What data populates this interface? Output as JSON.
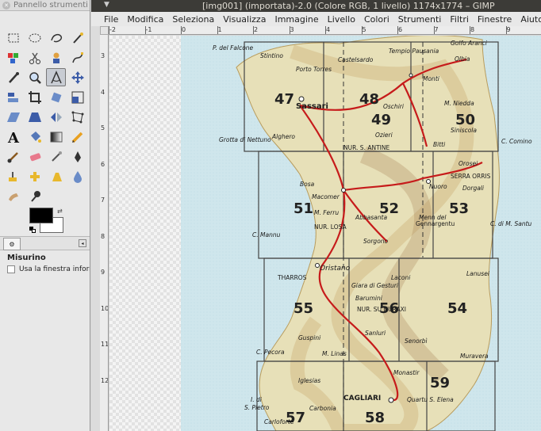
{
  "toolbox": {
    "title": "Pannello strumenti",
    "tools": [
      "rect-select-icon",
      "ellipse-select-icon",
      "free-select-icon",
      "fuzzy-select-icon",
      "color-select-icon",
      "scissors-icon",
      "foreground-select-icon",
      "paths-icon",
      "color-picker-icon",
      "zoom-icon",
      "measure-icon",
      "move-icon",
      "align-icon",
      "crop-icon",
      "rotate-icon",
      "scale-icon",
      "shear-icon",
      "perspective-icon",
      "flip-icon",
      "cage-icon",
      "text-icon",
      "bucket-fill-icon",
      "blend-icon",
      "pencil-icon",
      "paintbrush-icon",
      "eraser-icon",
      "airbrush-icon",
      "ink-icon",
      "clone-icon",
      "heal-icon",
      "perspective-clone-icon",
      "blur-icon",
      "smudge-icon",
      "dodge-burn-icon"
    ],
    "active_tool_index": 10,
    "fg_color": "#000000",
    "bg_color": "#ffffff"
  },
  "tool_options": {
    "tool_name": "Misurino",
    "option_label": "Usa la finestra informazioni"
  },
  "window": {
    "title": "[img001] (importata)-2.0 (Colore RGB, 1 livello) 1174x1774 – GIMP"
  },
  "menu": [
    "File",
    "Modifica",
    "Seleziona",
    "Visualizza",
    "Immagine",
    "Livello",
    "Colori",
    "Strumenti",
    "Filtri",
    "Finestre",
    "Aiuto"
  ],
  "rulers": {
    "horizontal": [
      "-2",
      "-1",
      "0",
      "1",
      "2",
      "3",
      "4",
      "5",
      "6",
      "7",
      "8",
      "9"
    ],
    "vertical": [
      "3",
      "4",
      "5",
      "6",
      "7",
      "8",
      "9",
      "10",
      "11",
      "12"
    ]
  },
  "map": {
    "sheet_numbers": [
      "47",
      "48",
      "49",
      "50",
      "51",
      "52",
      "53",
      "55",
      "56",
      "54",
      "59",
      "57",
      "58"
    ],
    "places": [
      "P. del Falcone",
      "Stintino",
      "Castelsardo",
      "Tempio Pausania",
      "Golfo Aranci",
      "Olbia",
      "Porto Torres",
      "Monti",
      "Sassari",
      "Oschiri",
      "M. Niedda",
      "Siniscola",
      "Ozieri",
      "Grotta di Nettuno",
      "Alghero",
      "Bitti",
      "C. Comino",
      "NUR. S. ANTINE",
      "Orosei",
      "SERRA ORRIS",
      "Bosa",
      "Nuoro",
      "Dorgali",
      "Macomer",
      "M. Ferru",
      "Gennargentu",
      "Abbasanta",
      "NUR. LOSA",
      "Sorgono",
      "Menn del",
      "C. Mannu",
      "Oristano",
      "THARROS",
      "Laconi",
      "Lanusei",
      "Giara di Gesturi",
      "Barumini",
      "NUR. SU NURAXI",
      "Sanluri",
      "Senorbì",
      "Guspini",
      "Muravera",
      "C. Pecora",
      "M. Linas",
      "Monastir",
      "Iglesias",
      "CAGLIARI",
      "Quartu S. Elena",
      "I. di S. Pietro",
      "Carbonia",
      "Carloforte",
      "C. di M. Santu"
    ]
  }
}
